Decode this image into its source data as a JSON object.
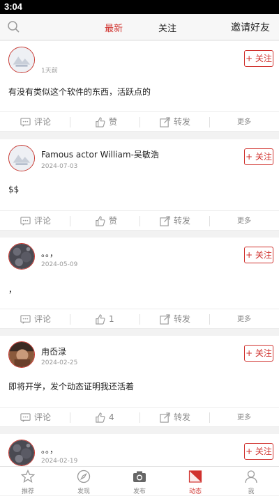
{
  "status_bar": {
    "time": "3:04"
  },
  "topbar": {
    "tabs": [
      {
        "label": "最新"
      },
      {
        "label": "关注"
      }
    ],
    "invite": "邀请好友"
  },
  "posts": [
    {
      "username": "",
      "time": "1天前",
      "content": "有没有类似这个软件的东西，活跃点的",
      "follow": "+ 关注",
      "comment": "评论",
      "like": "赞",
      "share": "转发",
      "more": "更多",
      "avatar": "placeholder"
    },
    {
      "username": "Famous actor William-吴敏浩",
      "time": "2024-07-03",
      "content": "$$",
      "follow": "+ 关注",
      "comment": "评论",
      "like": "赞",
      "share": "转发",
      "more": "更多",
      "avatar": "placeholder"
    },
    {
      "username": "。。，",
      "time": "2024-05-09",
      "content": "，",
      "follow": "+ 关注",
      "comment": "评论",
      "like": "1",
      "share": "转发",
      "more": "更多",
      "avatar": "dark"
    },
    {
      "username": "甪岙渌",
      "time": "2024-02-25",
      "content": "即将开学，发个动态证明我还活着",
      "follow": "+ 关注",
      "comment": "评论",
      "like": "4",
      "share": "转发",
      "more": "更多",
      "avatar": "photo"
    },
    {
      "username": "。。，",
      "time": "2024-02-19",
      "content": "",
      "follow": "+ 关注",
      "comment": "",
      "like": "",
      "share": "",
      "more": "",
      "avatar": "dark"
    }
  ],
  "bottom_nav": [
    {
      "label": "推荐",
      "icon": "star-icon"
    },
    {
      "label": "发现",
      "icon": "compass-icon"
    },
    {
      "label": "发布",
      "icon": "camera-icon"
    },
    {
      "label": "动态",
      "icon": "feed-icon",
      "active": true
    },
    {
      "label": "我",
      "icon": "person-icon"
    }
  ],
  "colors": {
    "accent": "#d0312d",
    "muted": "#888888"
  }
}
